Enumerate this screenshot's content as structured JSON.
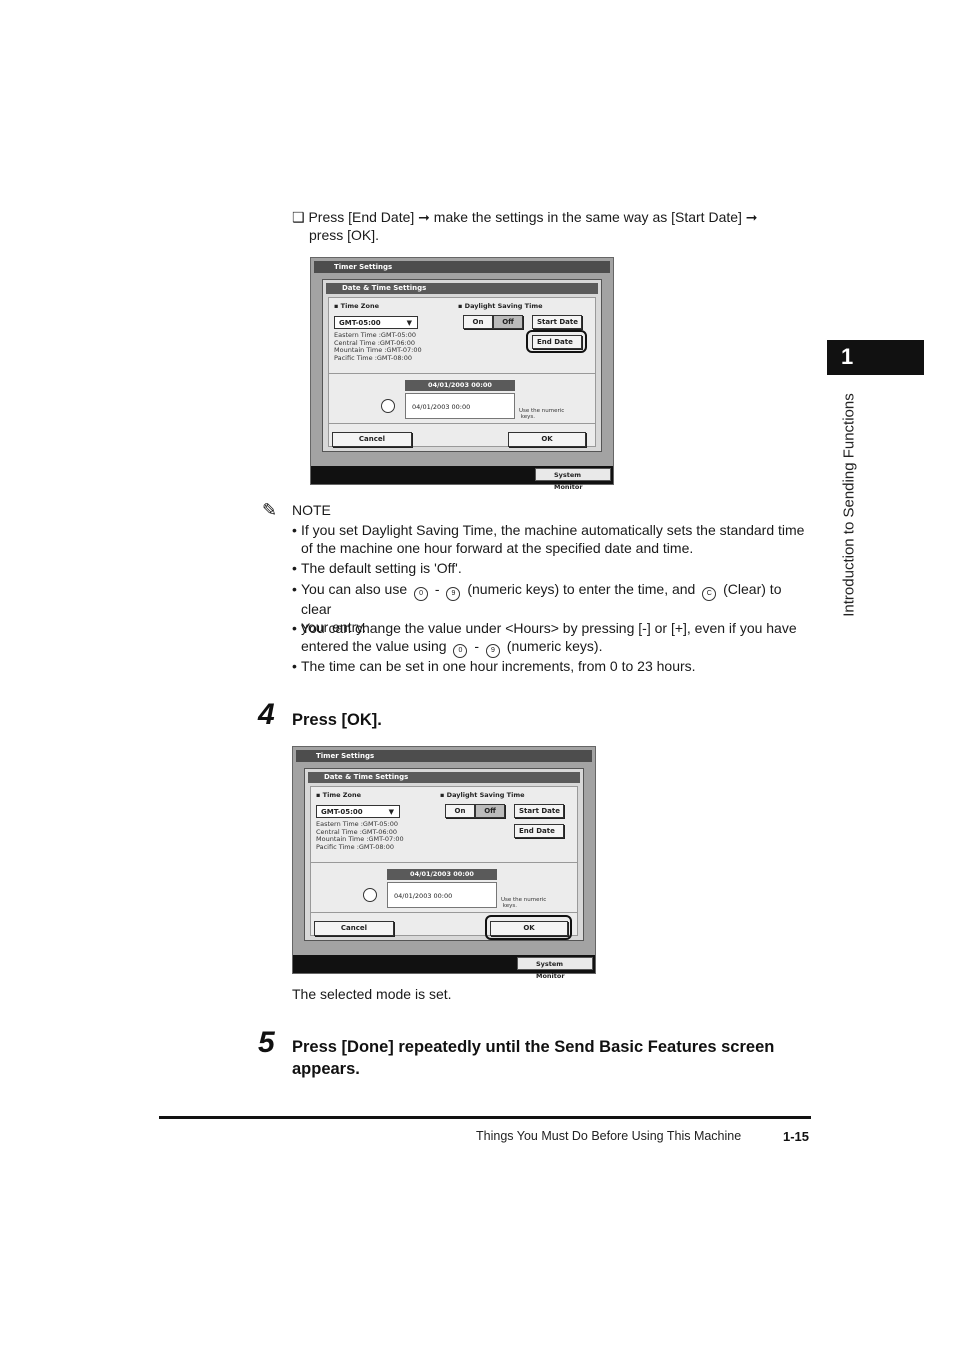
{
  "side": {
    "chapter": "1",
    "title": "Introduction to Sending Functions"
  },
  "intro": {
    "line1": "❑ Press [End Date] ➞ make the settings in the same way as [Start Date] ➞",
    "line2": "press [OK]."
  },
  "screen": {
    "title": "Timer Settings",
    "panel_title": "Date & Time Settings",
    "time_zone_label": "Time Zone",
    "time_zone_value": "GMT-05:00",
    "zones": "Eastern Time :GMT-05:00\nCentral Time :GMT-06:00\nMountain Time :GMT-07:00\nPacific Time :GMT-08:00",
    "dst_label": "Daylight Saving Time",
    "on": "On",
    "off": "Off",
    "start_date": "Start Date",
    "end_date": "End Date",
    "date_bar": "04/01/2003 00:00",
    "date_value": "04/01/2003 00:00",
    "hint": "Use the numeric\n keys.",
    "cancel": "Cancel",
    "ok": "OK",
    "system_monitor": "System Monitor"
  },
  "note": {
    "label": "NOTE",
    "items": [
      "If you set Daylight Saving Time, the machine automatically sets the standard time of the machine one hour forward at the specified date and time.",
      "The default setting is 'Off'.",
      "You can also use",
      "You can change the value under <Hours> by pressing [-] or [+], even if you have",
      "The time can be set in one hour increments, from 0 to 23 hours."
    ],
    "item3_mid": "(numeric keys) to enter the time, and",
    "item3_end": "(Clear) to clear",
    "item3_line2": "your entry.",
    "item4_line2a": "entered the value using",
    "item4_line2b": "(numeric keys).",
    "dash": "-",
    "key0": "0",
    "key9": "9",
    "keyC": "C"
  },
  "step4": {
    "num": "4",
    "title": "Press [OK].",
    "result": "The selected mode is set."
  },
  "step5": {
    "num": "5",
    "title_line1": "Press [Done] repeatedly until the Send Basic Features screen",
    "title_line2": "appears."
  },
  "footer": {
    "text": "Things You Must Do Before Using This Machine",
    "page": "1-15"
  }
}
